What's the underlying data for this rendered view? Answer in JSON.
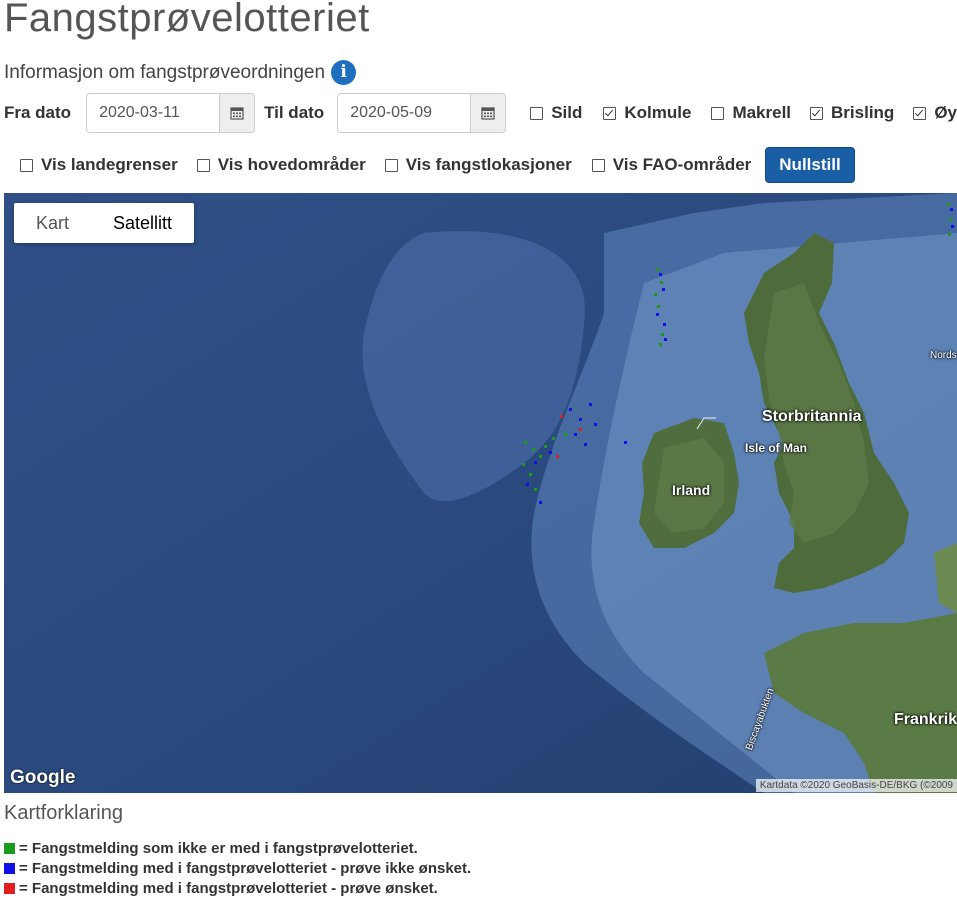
{
  "header": {
    "title": "Fangstprøvelotteriet",
    "info_link": "Informasjon om fangstprøveordningen",
    "info_icon": "info-icon"
  },
  "filters": {
    "from_label": "Fra dato",
    "from_value": "2020-03-11",
    "to_label": "Til dato",
    "to_value": "2020-05-09",
    "species": [
      {
        "label": "Sild",
        "checked": false
      },
      {
        "label": "Kolmule",
        "checked": true
      },
      {
        "label": "Makrell",
        "checked": false
      },
      {
        "label": "Brisling",
        "checked": true
      },
      {
        "label": "Øyepål",
        "checked": true
      }
    ]
  },
  "layers": {
    "items": [
      {
        "label": "Vis landegrenser",
        "checked": false
      },
      {
        "label": "Vis hovedområder",
        "checked": false
      },
      {
        "label": "Vis fangstlokasjoner",
        "checked": false
      },
      {
        "label": "Vis FAO-områder",
        "checked": false
      }
    ],
    "reset_label": "Nullstill"
  },
  "map": {
    "type_buttons": [
      "Kart",
      "Satellitt"
    ],
    "active_type": "Satellitt",
    "labels": {
      "storbritannia": "Storbritannia",
      "isle_of_man": "Isle of Man",
      "irland": "Irland",
      "frankrike": "Frankrik",
      "nordsjoen": "Nords",
      "biscaya": "Biscayabukten"
    },
    "logo": "Google",
    "attribution": "Kartdata ©2020 GeoBasis-DE/BKG (©2009"
  },
  "legend": {
    "title": "Kartforklaring",
    "items": [
      {
        "color": "#1a9a1a",
        "text": "= Fangstmelding som ikke er med i fangstprøvelotteriet."
      },
      {
        "color": "#1010e8",
        "text": "= Fangstmelding med i fangstprøvelotteriet - prøve ikke ønsket."
      },
      {
        "color": "#e02020",
        "text": "= Fangstmelding med i fangstprøvelotteriet - prøve ønsket."
      }
    ]
  }
}
